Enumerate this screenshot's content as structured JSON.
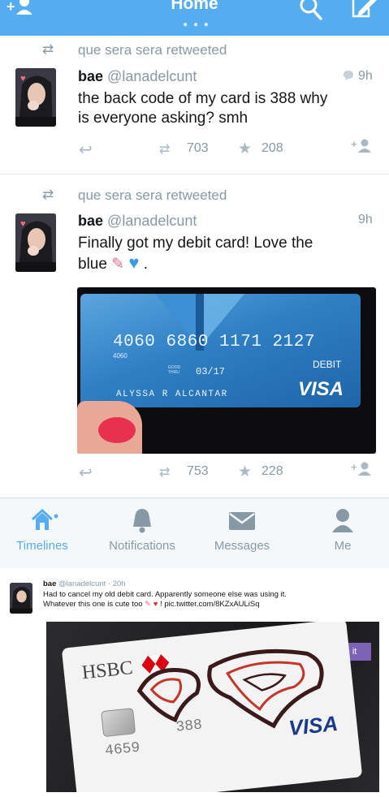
{
  "header": {
    "title": "Home",
    "dots": "● ● ●"
  },
  "tweet1": {
    "retweet_text": "que sera sera retweeted",
    "name": "bae",
    "handle": "@lanadelcunt",
    "time": "9h",
    "text_line1": "the back code of my card is 388 why",
    "text_line2": "is everyone asking? smh",
    "retweets": "703",
    "favorites": "208"
  },
  "tweet2": {
    "retweet_text": "que sera sera retweeted",
    "name": "bae",
    "handle": "@lanadelcunt",
    "time": "9h",
    "text_line1": "Finally got my debit card! Love the",
    "text_line2": "blue",
    "text_suffix": ".",
    "retweets": "753",
    "favorites": "228",
    "card": {
      "number": "4060 6860 1171 2127",
      "small_number": "4060",
      "good_thru_label": "GOOD THRU",
      "expiry": "03/17",
      "type_label": "DEBIT",
      "holder": "ALYSSA R ALCANTAR",
      "brand": "VISA"
    }
  },
  "tabs": [
    {
      "label": "Timelines",
      "icon": "home-icon"
    },
    {
      "label": "Notifications",
      "icon": "bell-icon"
    },
    {
      "label": "Messages",
      "icon": "envelope-icon"
    },
    {
      "label": "Me",
      "icon": "person-icon"
    }
  ],
  "tweet3": {
    "name": "bae",
    "handle_time": "@lanadelcunt · 20h",
    "text_line1": "Had to cancel my old debit card. Apparently someone else was using it.",
    "text_line2": "Whatever this one is cute too",
    "text_link": "! pic.twitter.com/8KZxAULiSq",
    "card": {
      "bank": "HSBC",
      "number_fragment": "4659",
      "cvv_fragment": "388",
      "brand": "VISA",
      "badge": "e it"
    }
  },
  "colors": {
    "accent": "#55acee",
    "muted": "#8899a6",
    "card_blue": "#2f7fc4"
  }
}
